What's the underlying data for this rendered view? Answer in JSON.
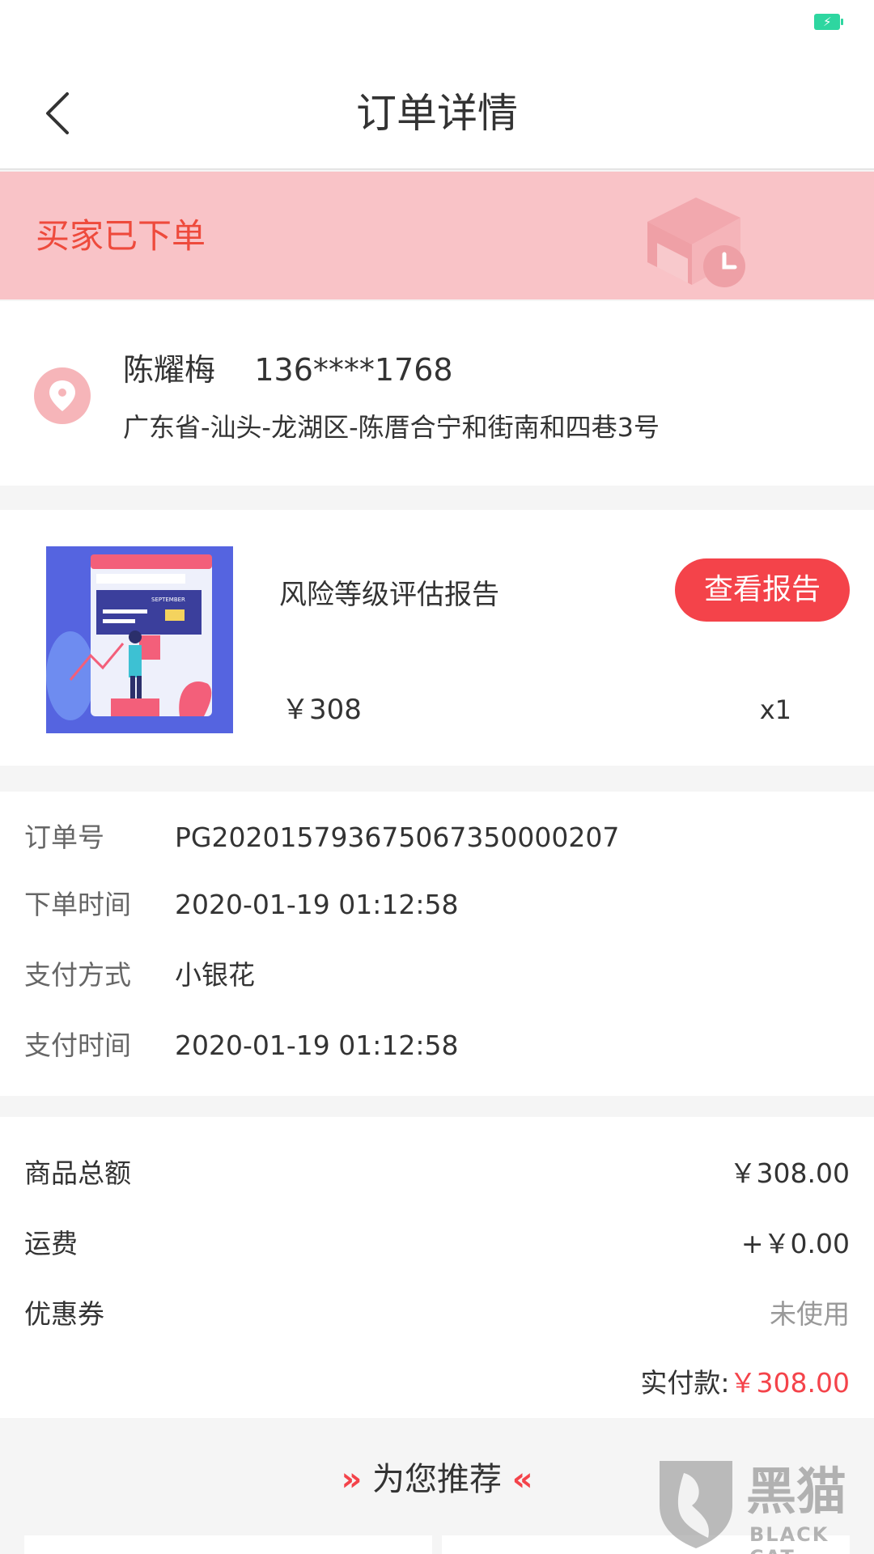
{
  "header": {
    "title": "订单详情"
  },
  "order_status": {
    "text": "买家已下单"
  },
  "address": {
    "name": "陈耀梅",
    "phone": "136****1768",
    "full_address": "广东省-汕头-龙湖区-陈厝合宁和街南和四巷3号"
  },
  "product": {
    "name": "风险等级评估报告",
    "price": "￥308",
    "quantity": "x1",
    "button_label": "查看报告",
    "thumb_text": "SEPTEMBER"
  },
  "order_info": {
    "rows": [
      {
        "label": "订单号",
        "value": "PG20201579367506735000​0207"
      },
      {
        "label": "下单时间",
        "value": "2020-01-19 01:12:58"
      },
      {
        "label": "支付方式",
        "value": "小银花"
      },
      {
        "label": "支付时间",
        "value": "2020-01-19 01:12:58"
      }
    ]
  },
  "amounts": {
    "goods_total_label": "商品总额",
    "goods_total_value": "￥308.00",
    "shipping_label": "运费",
    "shipping_value": "+￥0.00",
    "coupon_label": "优惠券",
    "coupon_value": "未使用",
    "paid_label": "实付款:",
    "paid_value": "￥308.00"
  },
  "recommend": {
    "title": "为您推荐"
  },
  "watermark": {
    "text": "黑猫",
    "sub": "BLACK CAT"
  },
  "colors": {
    "accent": "#f4434a",
    "banner_bg": "#f9c3c7",
    "status_text": "#ee4a3c"
  }
}
